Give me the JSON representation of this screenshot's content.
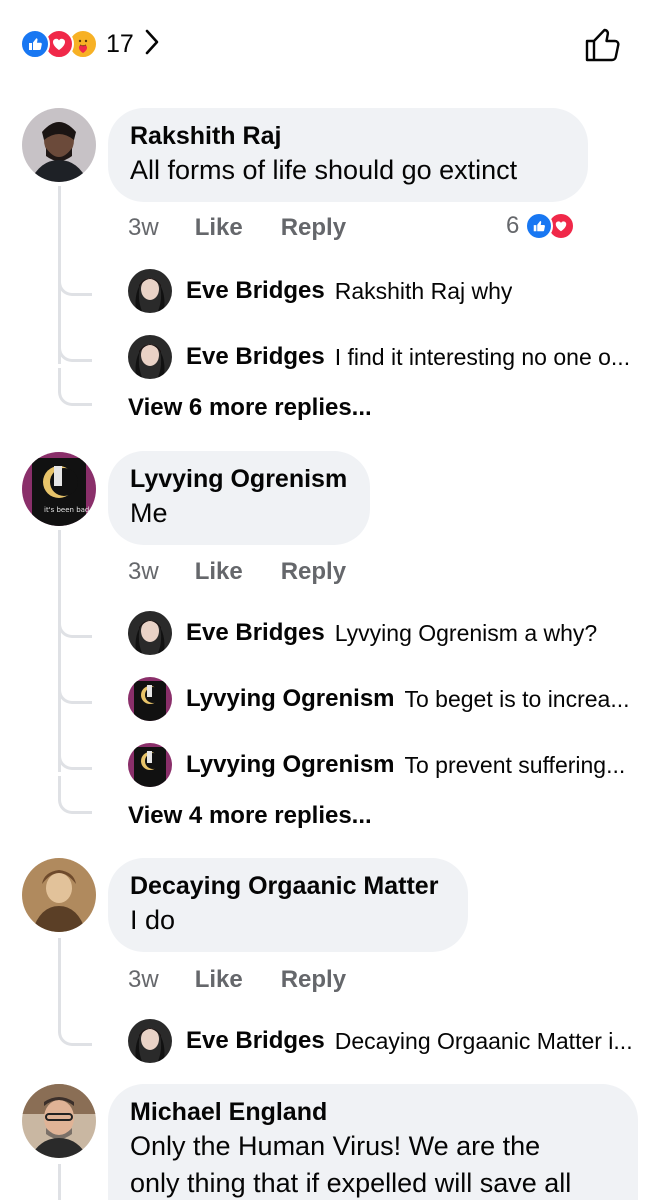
{
  "header": {
    "reaction_count": "17",
    "reaction_icons": [
      "like-icon",
      "love-icon",
      "care-icon"
    ],
    "like_icon": "thumbs-up-outline-icon"
  },
  "comments": [
    {
      "author": "Rakshith Raj",
      "text": "All forms of life should go extinct",
      "time": "3w",
      "like_label": "Like",
      "reply_label": "Reply",
      "reaction_count": "6",
      "replies": [
        {
          "author": "Eve Bridges",
          "text": "Rakshith Raj why"
        },
        {
          "author": "Eve Bridges",
          "text": "I find it interesting no one o..."
        }
      ],
      "more": "View 6 more replies..."
    },
    {
      "author": "Lyvying Ogrenism",
      "text": "Me",
      "time": "3w",
      "like_label": "Like",
      "reply_label": "Reply",
      "replies": [
        {
          "author": "Eve Bridges",
          "text": "Lyvying Ogrenism a why?"
        },
        {
          "author": "Lyvying Ogrenism",
          "text": "To beget is to increa..."
        },
        {
          "author": "Lyvying Ogrenism",
          "text": "To prevent suffering..."
        }
      ],
      "more": "View 4 more replies..."
    },
    {
      "author": "Decaying Orgaanic Matter",
      "text": "I do",
      "time": "3w",
      "like_label": "Like",
      "reply_label": "Reply",
      "replies": [
        {
          "author": "Eve Bridges",
          "text": "Decaying Orgaanic Matter i..."
        }
      ]
    },
    {
      "author": "Michael England",
      "text_line1": "Only the Human Virus! We are the",
      "text_line2": "only thing that if expelled will save all"
    }
  ],
  "colors": {
    "bubble": "#f0f2f5",
    "meta": "#65676b",
    "like_blue": "#1877f2",
    "love_red": "#f02849",
    "care_yellow": "#f7b125"
  }
}
